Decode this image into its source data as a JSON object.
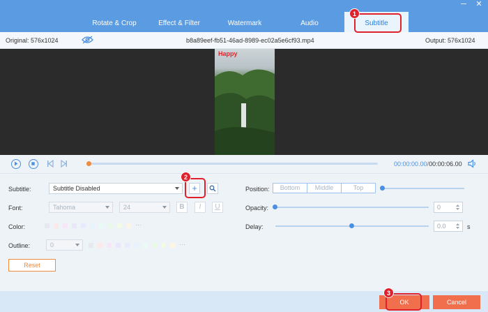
{
  "tabs": [
    {
      "label": "Rotate & Crop"
    },
    {
      "label": "Effect & Filter"
    },
    {
      "label": "Watermark"
    },
    {
      "label": "Audio"
    },
    {
      "label": "Subtitle"
    }
  ],
  "window": {
    "minimize": "─",
    "close": "✕"
  },
  "infobar": {
    "original": "Original: 576x1024",
    "filename": "b8a89eef-fb51-46ad-8989-ec02a5e6cf93.mp4",
    "output": "Output: 576x1024"
  },
  "video": {
    "overlay_text": "Happy"
  },
  "playback": {
    "current": "00:00:00.00",
    "separator": "/",
    "total": "00:00:06.00",
    "progress": 0.0
  },
  "subtitle": {
    "label": "Subtitle:",
    "value": "Subtitle Disabled"
  },
  "font": {
    "label": "Font:",
    "family": "Tahoma",
    "size": "24",
    "bold": "B",
    "italic": "I",
    "underline": "U"
  },
  "color": {
    "label": "Color:"
  },
  "outline": {
    "label": "Outline:",
    "value": "0"
  },
  "position": {
    "label": "Position:",
    "options": [
      "Bottom",
      "Middle",
      "Top"
    ],
    "level": 0.0
  },
  "opacity": {
    "label": "Opacity:",
    "value": "0",
    "level": 0.0
  },
  "delay": {
    "label": "Delay:",
    "value": "0.0",
    "unit": "s",
    "level": 0.5
  },
  "buttons": {
    "reset": "Reset",
    "ok": "OK",
    "cancel": "Cancel",
    "add": "+"
  },
  "annotations": [
    "1",
    "2",
    "3"
  ],
  "colors": {
    "accent": "#4a90e2",
    "header": "#5b9be1",
    "orange": "#f26f4d",
    "annotation": "#e0202a"
  }
}
